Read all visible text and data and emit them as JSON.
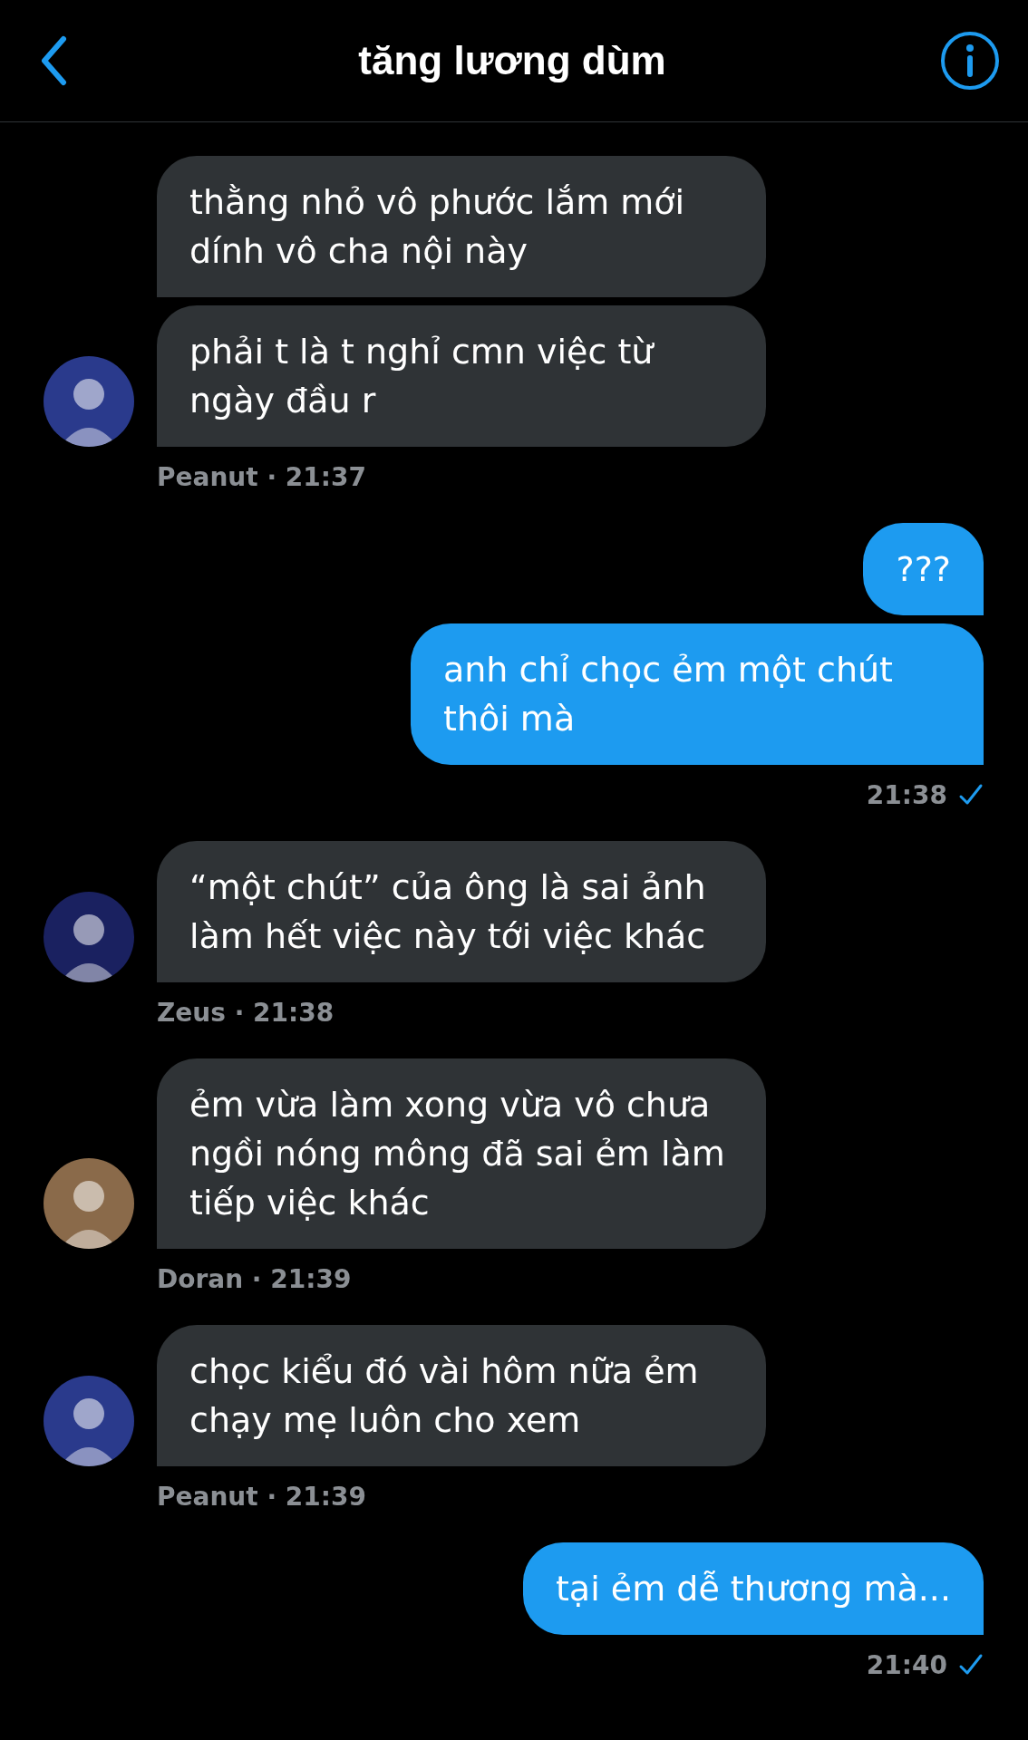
{
  "header": {
    "title": "tăng lương dùm"
  },
  "groups": [
    {
      "kind": "received",
      "meta": "Peanut · 21:37",
      "color": "#2a3a8c",
      "messages": [
        "thằng nhỏ vô phước lắm mới dính vô cha nội này",
        "phải t là t nghỉ cmn việc từ ngày đầu r"
      ]
    },
    {
      "kind": "sent",
      "meta": "21:38",
      "read": true,
      "messages": [
        "???",
        "anh chỉ chọc ẻm một chút thôi mà"
      ]
    },
    {
      "kind": "received",
      "meta": "Zeus · 21:38",
      "color": "#1a2160",
      "messages": [
        "“một chút” của ông là sai ảnh làm hết việc này tới việc khác"
      ]
    },
    {
      "kind": "received",
      "meta": "Doran · 21:39",
      "color": "#8a6a4a",
      "messages": [
        "ẻm vừa làm xong vừa vô chưa ngồi nóng mông đã sai ẻm làm tiếp việc khác"
      ]
    },
    {
      "kind": "received",
      "meta": "Peanut · 21:39",
      "color": "#2a3a8c",
      "messages": [
        "chọc kiểu đó vài hôm nữa ẻm chạy mẹ luôn cho xem"
      ]
    },
    {
      "kind": "sent",
      "meta": "21:40",
      "read": true,
      "messages": [
        "tại ẻm dễ thương mà..."
      ]
    }
  ]
}
